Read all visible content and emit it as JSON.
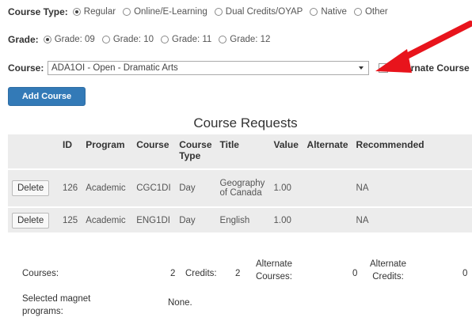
{
  "course_type": {
    "label": "Course Type:",
    "options": [
      {
        "label": "Regular",
        "selected": true
      },
      {
        "label": "Online/E-Learning",
        "selected": false
      },
      {
        "label": "Dual Credits/OYAP",
        "selected": false
      },
      {
        "label": "Native",
        "selected": false
      },
      {
        "label": "Other",
        "selected": false
      }
    ]
  },
  "grade": {
    "label": "Grade:",
    "options": [
      {
        "label": "Grade: 09",
        "selected": true
      },
      {
        "label": "Grade: 10",
        "selected": false
      },
      {
        "label": "Grade: 11",
        "selected": false
      },
      {
        "label": "Grade: 12",
        "selected": false
      }
    ]
  },
  "course": {
    "label": "Course:",
    "selected": "ADA1OI - Open - Dramatic Arts",
    "alternate_label": "Alternate Course"
  },
  "add_button": "Add Course",
  "annotation": {
    "arrow_color": "#e8141c"
  },
  "table": {
    "title": "Course Requests",
    "headers": [
      "",
      "ID",
      "Program",
      "Course",
      "Course Type",
      "Title",
      "Value",
      "Alternate",
      "Recommended"
    ],
    "rows": [
      {
        "action": "Delete",
        "id": "126",
        "program": "Academic",
        "course": "CGC1DI",
        "type": "Day",
        "title": "Geography of Canada",
        "value": "1.00",
        "alternate": "",
        "recommended": "NA"
      },
      {
        "action": "Delete",
        "id": "125",
        "program": "Academic",
        "course": "ENG1DI",
        "type": "Day",
        "title": "English",
        "value": "1.00",
        "alternate": "",
        "recommended": "NA"
      }
    ]
  },
  "summary": {
    "courses_label": "Courses:",
    "courses_value": "2",
    "credits_label": "Credits:",
    "credits_value": "2",
    "alt_courses_label": "Alternate Courses:",
    "alt_courses_value": "0",
    "alt_credits_label": "Alternate Credits:",
    "alt_credits_value": "0",
    "magnet_label": "Selected magnet programs:",
    "magnet_value": "None."
  },
  "colors": {
    "primary_button": "#337ab7",
    "table_bg": "#ececec"
  }
}
